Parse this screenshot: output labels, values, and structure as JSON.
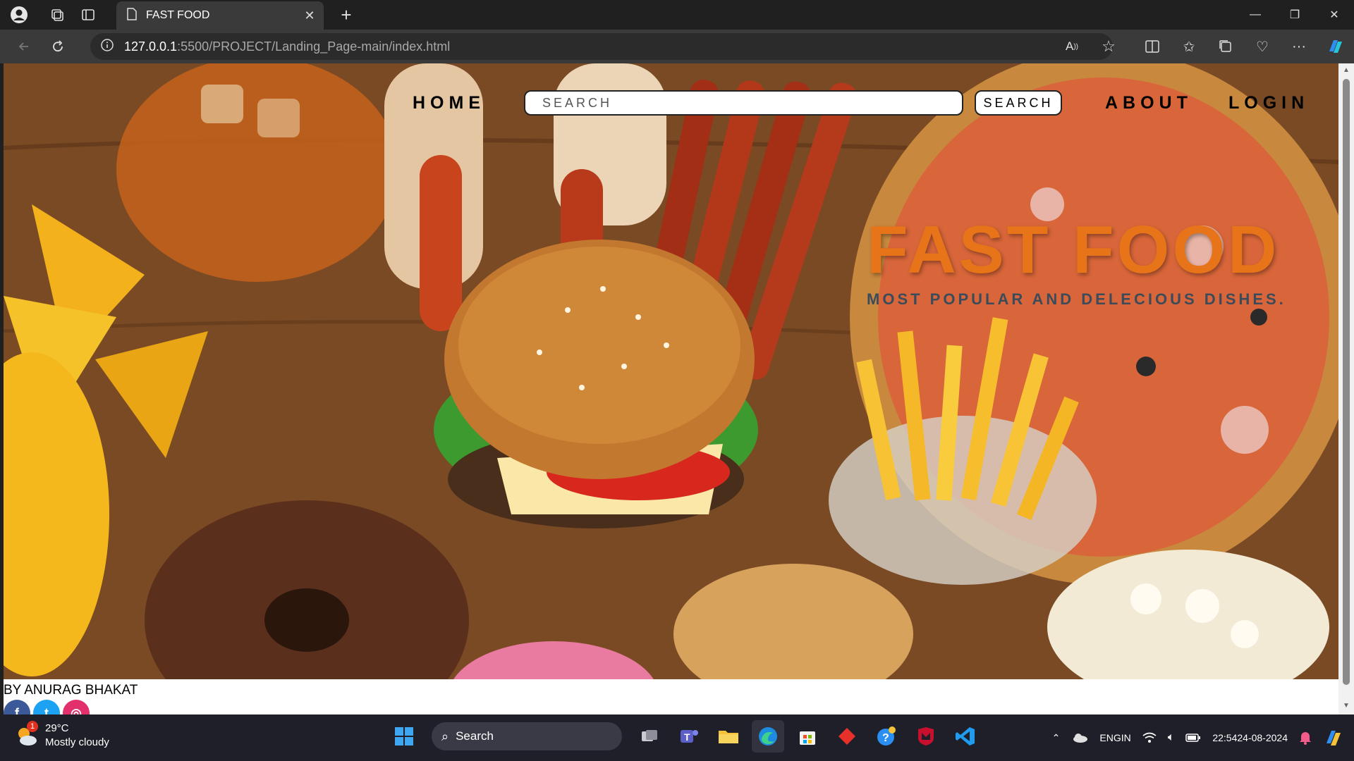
{
  "browser": {
    "tab_title": "FAST FOOD",
    "url_host": "127.0.0.1",
    "url_rest": ":5500/PROJECT/Landing_Page-main/index.html"
  },
  "page": {
    "nav": {
      "home": "HOME",
      "search_placeholder": "SEARCH",
      "search_button": "SEARCH",
      "about": "ABOUT",
      "login": "LOGIN"
    },
    "hero": {
      "title": "FAST FOOD",
      "subtitle": "MOST POPULAR AND DELECIOUS DISHES."
    },
    "footer": {
      "credit": "BY ANURAG BHAKAT",
      "social": [
        {
          "name": "facebook-icon",
          "glyph": "f",
          "color": "#3b5998"
        },
        {
          "name": "twitter-icon",
          "glyph": "t",
          "color": "#1da1f2"
        },
        {
          "name": "instagram-icon",
          "glyph": "◎",
          "color": "#e1306c"
        }
      ]
    }
  },
  "taskbar": {
    "weather_temp": "29°C",
    "weather_desc": "Mostly cloudy",
    "weather_badge": "1",
    "search_label": "Search",
    "lang_top": "ENG",
    "lang_bottom": "IN",
    "time": "22:54",
    "date": "24-08-2024"
  }
}
